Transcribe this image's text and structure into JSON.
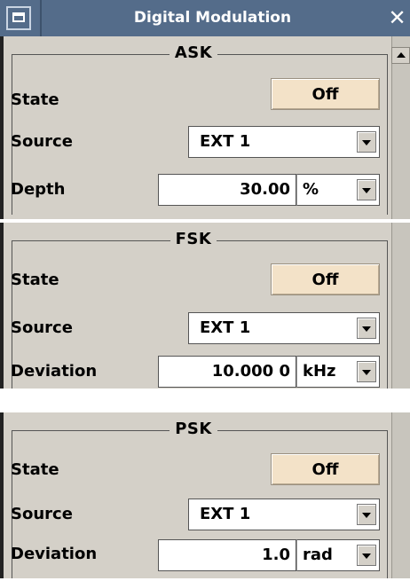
{
  "window": {
    "title": "Digital Modulation"
  },
  "sections": [
    {
      "legend": "ASK",
      "state_label": "State",
      "state_value": "Off",
      "source_label": "Source",
      "source_value": "EXT 1",
      "param_label": "Depth",
      "param_value": "30.00",
      "param_unit": "%"
    },
    {
      "legend": "FSK",
      "state_label": "State",
      "state_value": "Off",
      "source_label": "Source",
      "source_value": "EXT 1",
      "param_label": "Deviation",
      "param_value": "10.000 0",
      "param_unit": "kHz"
    },
    {
      "legend": "PSK",
      "state_label": "State",
      "state_value": "Off",
      "source_label": "Source",
      "source_value": "EXT 1",
      "param_label": "Deviation",
      "param_value": "1.0",
      "param_unit": "rad"
    }
  ],
  "colors": {
    "titlebar": "#546c8a",
    "panel_bg": "#d4d0c8",
    "state_button": "#f3e2c8"
  }
}
